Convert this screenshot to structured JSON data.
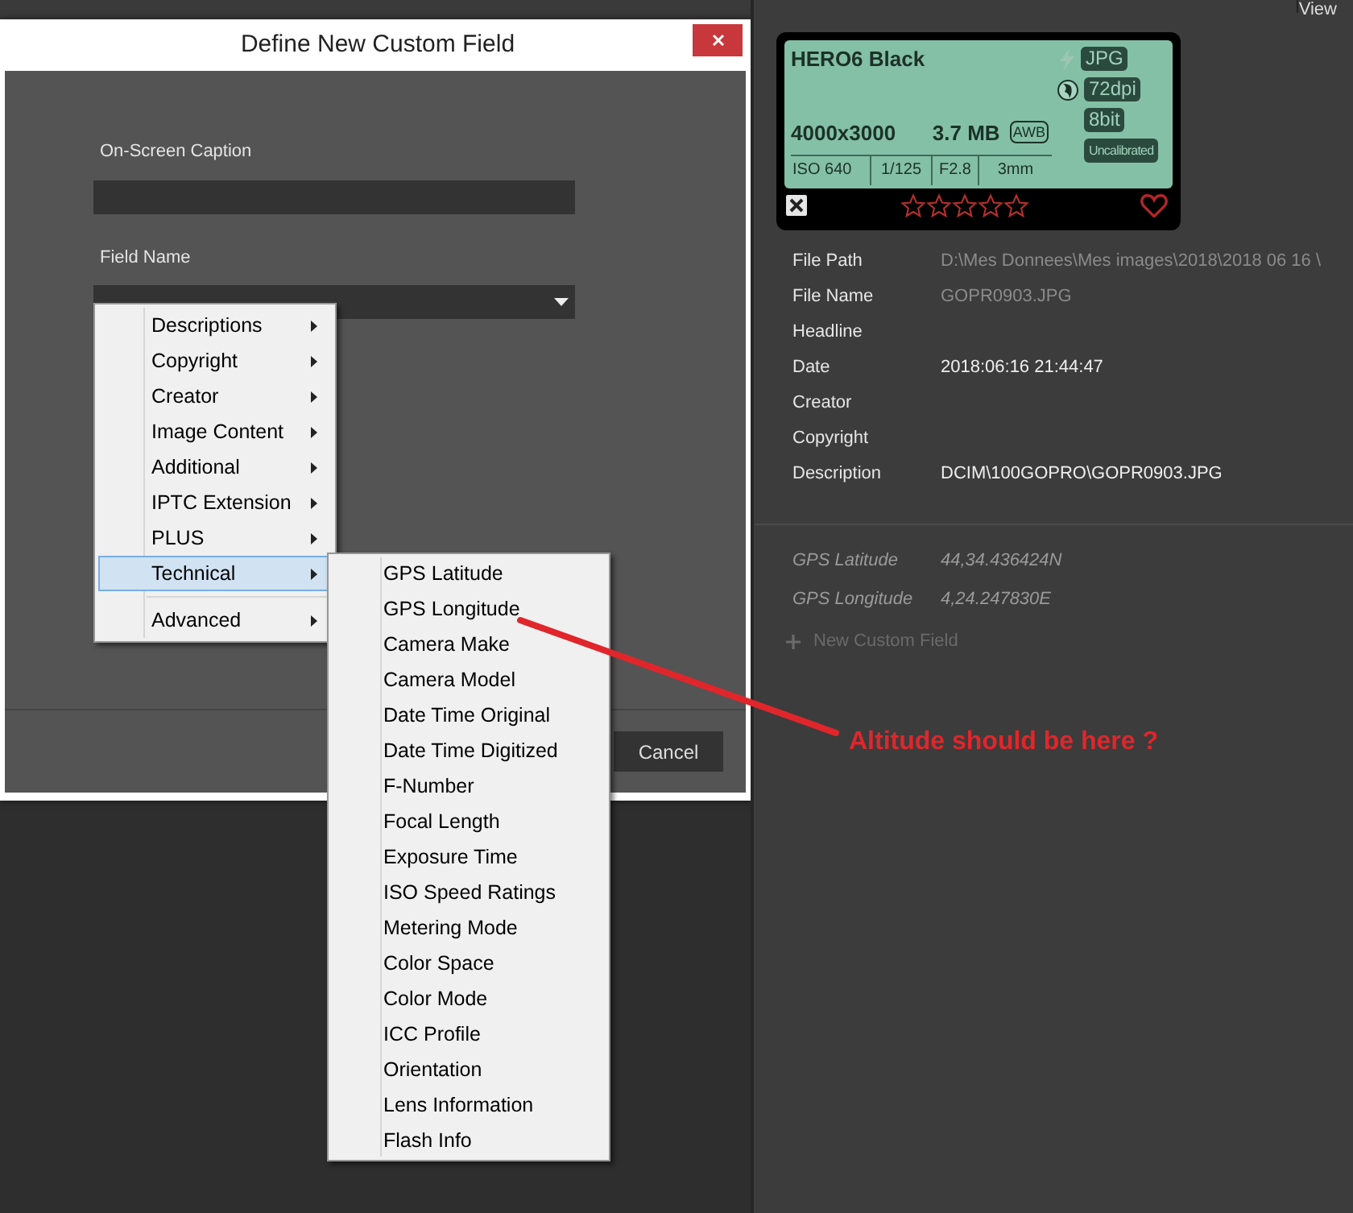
{
  "view_label": "View",
  "dialog": {
    "title": "Define New Custom Field",
    "caption_label": "On-Screen Caption",
    "field_name_label": "Field Name",
    "cancel": "Cancel"
  },
  "menu": {
    "items": [
      {
        "kind": "submenu",
        "label": "Descriptions",
        "selected": false
      },
      {
        "kind": "submenu",
        "label": "Copyright",
        "selected": false
      },
      {
        "kind": "submenu",
        "label": "Creator",
        "selected": false
      },
      {
        "kind": "submenu",
        "label": "Image Content",
        "selected": false
      },
      {
        "kind": "submenu",
        "label": "Additional",
        "selected": false
      },
      {
        "kind": "submenu",
        "label": "IPTC Extension",
        "selected": false
      },
      {
        "kind": "submenu",
        "label": "PLUS",
        "selected": false
      },
      {
        "kind": "submenu",
        "label": "Technical",
        "selected": true
      },
      {
        "kind": "separator"
      },
      {
        "kind": "submenu",
        "label": "Advanced",
        "selected": false
      }
    ]
  },
  "submenu": {
    "items": [
      "GPS Latitude",
      "GPS Longitude",
      "Camera Make",
      "Camera Model",
      "Date Time Original",
      "Date Time Digitized",
      "F-Number",
      "Focal Length",
      "Exposure Time",
      "ISO Speed Ratings",
      "Metering Mode",
      "Color Space",
      "Color Mode",
      "ICC Profile",
      "Orientation",
      "Lens Information",
      "Flash Info"
    ]
  },
  "annotation": {
    "text": "Altitude should be here ?"
  },
  "camera_card": {
    "model": "HERO6 Black",
    "format": "JPG",
    "dpi": "72dpi",
    "dimensions": "4000x3000",
    "size": "3.7 MB",
    "awb": "AWB",
    "bit_depth": "8bit",
    "iso": "ISO 640",
    "shutter": "1/125",
    "aperture": "F2.8",
    "focal": "3mm",
    "calibration": "Uncalibrated",
    "stars": 0,
    "favorite": false
  },
  "metadata": [
    {
      "label": "File Path",
      "value": "D:\\Mes Donnees\\Mes images\\2018\\2018 06 16 \\",
      "dimmed": true
    },
    {
      "label": "File Name",
      "value": "GOPR0903.JPG",
      "dimmed": true
    },
    {
      "label": "Headline"
    },
    {
      "label": "Date",
      "value": "2018:06:16 21:44:47",
      "dimmed": false
    },
    {
      "label": "Creator"
    },
    {
      "label": "Copyright"
    },
    {
      "label": "Description",
      "value": "DCIM\\100GOPRO\\GOPR0903.JPG",
      "dimmed": false
    }
  ],
  "custom_fields": [
    {
      "label": "GPS Latitude",
      "value": "44,34.436424N"
    },
    {
      "label": "GPS Longitude",
      "value": "4,24.247830E"
    }
  ],
  "new_custom_field": "New Custom Field"
}
